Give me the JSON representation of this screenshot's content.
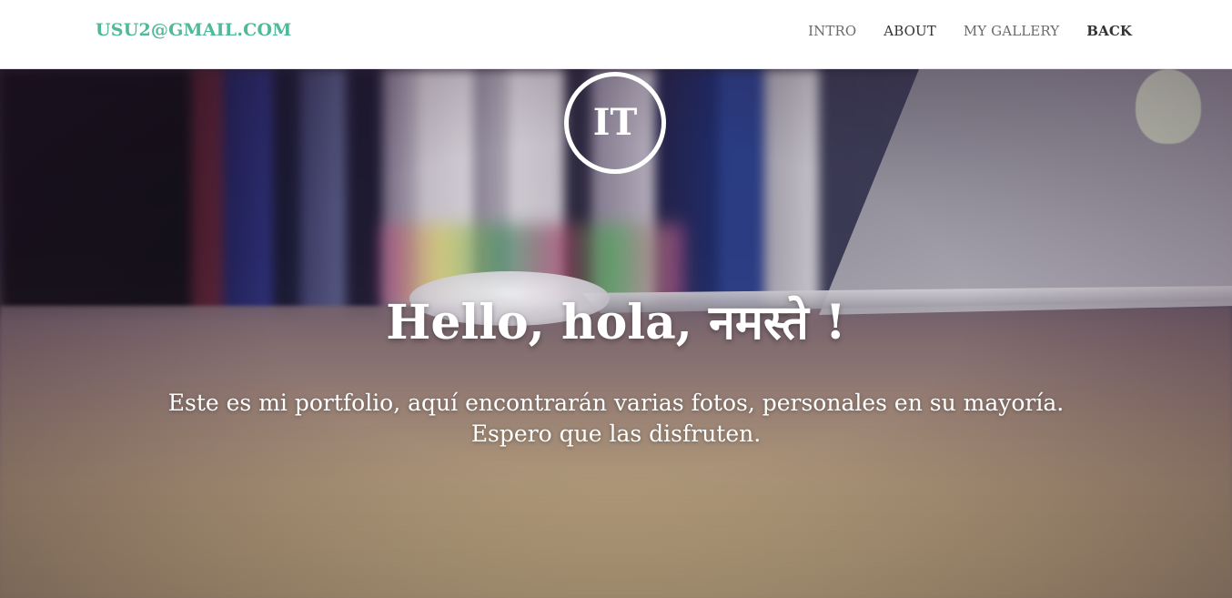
{
  "colors": {
    "brand": "#4fb99a",
    "nav_text": "#6b6b6b",
    "nav_active": "#333333",
    "hero_text": "#ffffff"
  },
  "navbar": {
    "brand": "USU2@GMAIL.COM",
    "links": [
      {
        "label": "INTRO"
      },
      {
        "label": "ABOUT"
      },
      {
        "label": "MY GALLERY"
      },
      {
        "label": "BACK"
      }
    ]
  },
  "hero": {
    "logo_initials": "IT",
    "title": "Hello, hola, नमस्ते !",
    "text_line1": "Este es mi portfolio, aquí encontrarán varias fotos, personales en su mayoría.",
    "text_line2": "Espero que las disfruten."
  }
}
